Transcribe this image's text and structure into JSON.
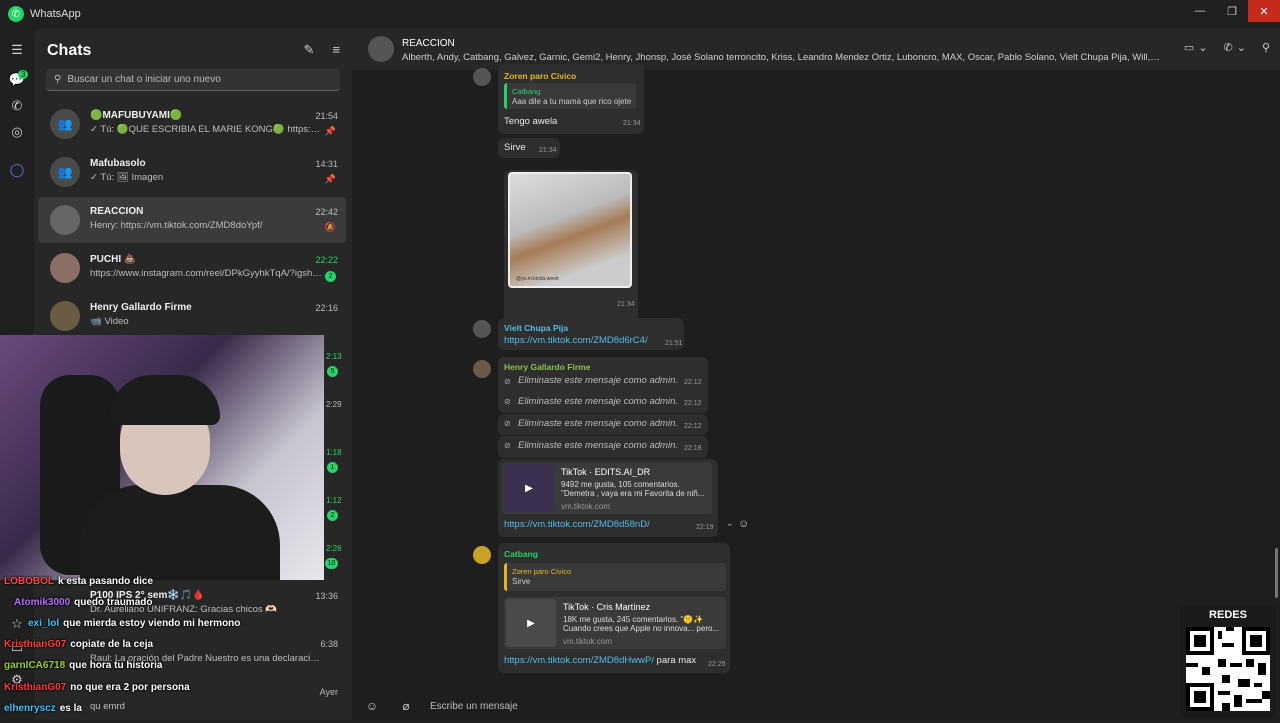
{
  "window": {
    "title": "WhatsApp",
    "minimize": "—",
    "maximize": "❐",
    "close": "✕"
  },
  "rail": {
    "badge": "3"
  },
  "chatlist": {
    "header": "Chats",
    "search_placeholder": "Buscar un chat o iniciar uno nuevo",
    "items": [
      {
        "name": "🟢MAFUBUYAMI🟢",
        "preview": "✓ Tú: 🟢QUE ESCRIBIA EL MARIE KONG🟢 https://kic...",
        "time": "21:54",
        "meta": "📌"
      },
      {
        "name": "Mafubasolo",
        "preview": "✓ Tú: 🖼 Imagen",
        "time": "14:31",
        "meta": "📌"
      },
      {
        "name": "REACCION",
        "preview": "Henry: https://vm.tiktok.com/ZMD8doYpf/",
        "time": "22:42",
        "meta": "🔕"
      },
      {
        "name": "PUCHI 💩",
        "preview": "https://www.instagram.com/reel/DPkGyyhkTqA/?igsh=...",
        "time": "22:22",
        "unread": "2"
      },
      {
        "name": "Henry Gallardo Firme",
        "preview": "📹 Video",
        "time": "22:16",
        "meta": ""
      }
    ],
    "partial_times": [
      "2:13",
      "2:29",
      "1:18",
      "1:12",
      "2:26"
    ],
    "partial_unread": [
      "5",
      "1",
      "2",
      "10"
    ],
    "lower_items": [
      {
        "name": "P100 IPS 2° sem❄️🎵🩸",
        "preview": "Dr. Aureliano UNIFRANZ: Gracias chicos 🫶🏻",
        "time": "13:36"
      },
      {
        "name": "",
        "preview": "Raul: La oración del Padre Nuestro es una declaración d...",
        "time": "6:38"
      },
      {
        "name": "",
        "preview": "qu emrd",
        "time": "Ayer"
      }
    ]
  },
  "twitch_chat": [
    {
      "user": "LOBOBOL",
      "color": "#ff4444",
      "msg": "k esta pasando dice"
    },
    {
      "user": "Atomik3000",
      "color": "#b36bff",
      "msg": "quedo traumado"
    },
    {
      "user": "exi_lol",
      "color": "#3cc4ff",
      "msg": "que mierda estoy viendo mi hermono"
    },
    {
      "user": "KristhianG07",
      "color": "#ff3b3b",
      "msg": "copiate de la ceja"
    },
    {
      "user": "garnICA6718",
      "color": "#9acd32",
      "msg": "que hora tu historia"
    },
    {
      "user": "KristhianG07",
      "color": "#ff3b3b",
      "msg": "no que era 2 por persona"
    },
    {
      "user": "elhenryscz",
      "color": "#3cc4ff",
      "msg": "es la"
    }
  ],
  "conversation": {
    "name": "REACCION",
    "members": "Alberth, Andy, Catbang, Galvez, Garnic, Gemi2, Henry, Jhonsp, José Solano terroncito, Kriss, Leandro Mendez Ortiz, Luboncro, MAX, Oscar, Pablo Solano, Vielt Chupa Pija, Will, Zoren pa...",
    "messages": {
      "m1_sender": "Zoren paro Civico",
      "m1_quote_name": "Catbang",
      "m1_quote_text": "Aaa dile a tu mamá que rico ojete",
      "m1_text": "Tengo awela",
      "m1_time": "21:34",
      "m2_text": "Sirve",
      "m2_time": "21:34",
      "m3_caption": "@yo.m.kinda.weeb",
      "m3_time": "21:34",
      "m4_sender": "Vielt Chupa Pija",
      "m4_text": "https://vm.tiktok.com/ZMD8d6rC4/",
      "m4_time": "21:51",
      "m5_sender": "Henry Gallardo Firme",
      "deleted_text": "Eliminaste este mensaje como admin.",
      "deleted_times": [
        "22:12",
        "22:12",
        "22:12",
        "22:18"
      ],
      "m5_card_title": "TikTok ·      EDITS.AI_DR",
      "m5_card_line1": "9492 me gusta, 105 comentarios.",
      "m5_card_line2": "\"Demetra , vaya era mi Favorita de niñ...",
      "m5_card_domain": "vm.tiktok.com",
      "m5_link": "https://vm.tiktok.com/ZMD8d58nD/",
      "m5_time": "22:19",
      "m6_sender": "Catbang",
      "m6_quote_name": "Zoren paro Civico",
      "m6_quote_text": "Sirve",
      "m6_card_title": "TikTok · Cris Martínez",
      "m6_card_line1": "18K me gusta, 245 comentarios. \"🤫✨",
      "m6_card_line2": "Cuando crees que Apple no innova... pero...",
      "m6_card_domain": "vm.tiktok.com",
      "m6_link": "https://vm.tiktok.com/ZMD8dHwwP/",
      "m6_link_suffix": " para max",
      "m6_time": "22:25"
    },
    "composer_placeholder": "Escribe un mensaje"
  },
  "overlay": {
    "qr_label": "REDES"
  }
}
